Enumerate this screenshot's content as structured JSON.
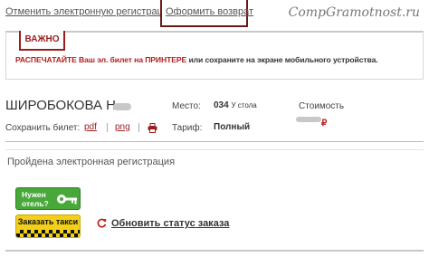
{
  "top": {
    "cancel_registration": "Отменить электронную регистрацию",
    "refund": "Оформить возврат",
    "watermark": "CompGramotnost.ru"
  },
  "notice": {
    "badge": "ВАЖНО",
    "text_red": "РАСПЕЧАТАЙТЕ Ваш эл. билет на ПРИНТЕРЕ",
    "text_rest": " или сохраните на экране мобильного устройства."
  },
  "ticket": {
    "passenger_name": "ШИРОБОКОВА Н.",
    "seat_label": "Место:",
    "seat_number": "034",
    "seat_note": "У стола",
    "cost_label": "Стоимость",
    "save_label": "Сохранить билет:",
    "pdf": "pdf",
    "png": "png",
    "tariff_label": "Тариф:",
    "tariff_value": "Полный",
    "currency": "₽"
  },
  "registration": {
    "status": "Пройдена электронная регистрация"
  },
  "services": {
    "hotel": "Нужен отель?",
    "taxi": "Заказать такси",
    "refresh": "Обновить статус заказа"
  },
  "colors": {
    "accent_dark_red": "#9b1c1c",
    "refund_border": "#6d1818",
    "hotel_green": "#48a83a",
    "taxi_yellow": "#f1cf1a"
  },
  "icons": [
    "printer-icon",
    "key-icon",
    "refresh-icon"
  ]
}
